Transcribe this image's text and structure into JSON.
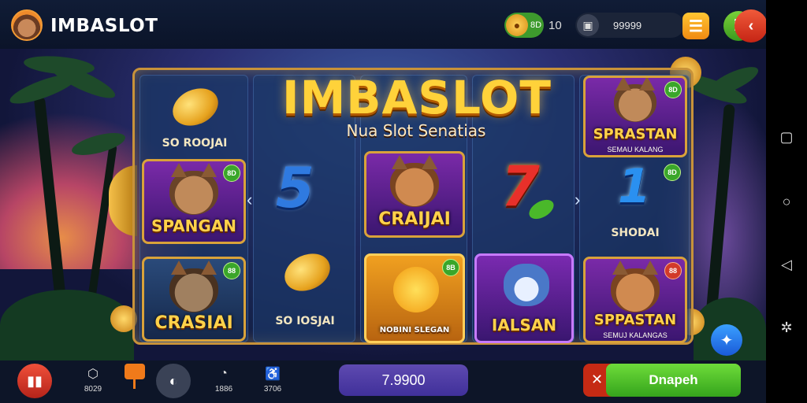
{
  "header": {
    "app_title": "IMBASLOT",
    "coin_badge": "8D",
    "coin_count": "10",
    "wallet_value": "99999",
    "colors": {
      "accent": "#f39b35",
      "green": "#3d9a2d",
      "red": "#c52414"
    }
  },
  "banner": {
    "title": "IMBASLOT",
    "subtitle": "Nua Slot Senatias"
  },
  "reels": {
    "reel1": {
      "top_label": "SO ROOJAI",
      "tile1_label": "SPANGAN",
      "tile1_badge": "8D",
      "tile2_label": "CRASIAI",
      "tile2_badge": "88"
    },
    "reel2": {
      "number": "5",
      "bottom_label": "SO IOSJAI"
    },
    "reel3": {
      "tile1_label": "CRAIJAI",
      "tile2_label": "NOBINI SLEGAN",
      "tile2_badge": "8B"
    },
    "reel4": {
      "number": "7",
      "tile_label": "IALSAN"
    },
    "reel5": {
      "tile1_label": "SPRASTAN",
      "tile1_sub": "SEMAU KALANG",
      "tile1_badge": "8D",
      "number": "1",
      "number_badge": "8D",
      "mid_label": "SHODAI",
      "tile2_label": "SPPASTAN",
      "tile2_sub": "SEMUJ KALANGAS",
      "tile2_badge": "88"
    }
  },
  "bottom": {
    "item1_label": "8029",
    "item2_label": "1886",
    "item3_label": "3706",
    "balance": "7.9900",
    "play_label": "Dnapeh"
  },
  "icons": {
    "home": "home-icon",
    "gift": "gift-icon",
    "chip": "chip-icon",
    "nav": [
      "recents-icon",
      "home-circle-icon",
      "back-triangle-icon",
      "settings-gear-icon"
    ]
  }
}
